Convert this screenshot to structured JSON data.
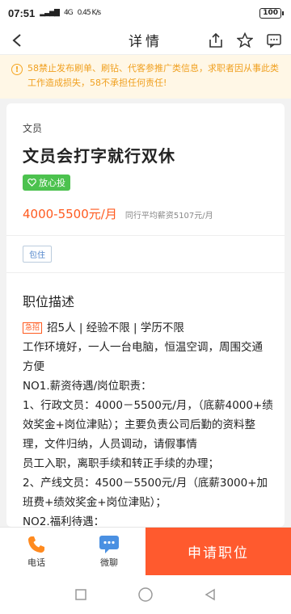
{
  "status_bar": {
    "time": "07:51",
    "signal": "4G",
    "speed": "0.45 K/s",
    "battery": "100"
  },
  "nav": {
    "title": "详情"
  },
  "notice": {
    "text": "58禁止发布刷单、刷钻、代客参推广类信息，求职者因从事此类工作造成损失，58不承担任何责任!"
  },
  "job": {
    "category": "文员",
    "title": "文员会打字就行双休",
    "badge": "放心投",
    "salary": "4000-5500元/月",
    "avg_salary": "同行平均薪资5107元/月",
    "tag": "包住",
    "section_title": "职位描述",
    "urgent_label": "急招",
    "requirements": "招5人 | 经验不限 | 学历不限",
    "description_lines": [
      "工作环境好，一人一台电脑，恒温空调，周围交通方便",
      "NO1.薪资待遇/岗位职责：",
      "1、行政文员：4000－5500元/月，（底薪4000+绩效奖金+岗位津贴）；主要负责公司后勤的资料整理，文件归纳，人员调动，请假事情",
      "员工入职，离职手续和转正手续的办理；",
      "2、产线文员：4500－5500元/月（底薪3000+加班费+绩效奖金+岗位津贴）；",
      "NO2.福利待遇："
    ]
  },
  "bottom_bar": {
    "phone_label": "电话",
    "chat_label": "微聊",
    "apply_label": "申请职位"
  },
  "colors": {
    "accent": "#ff5a2e",
    "notice": "#f0a020",
    "badge": "#4cc24e",
    "tag": "#5588cc"
  }
}
